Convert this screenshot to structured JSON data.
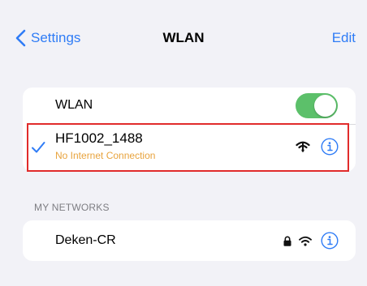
{
  "nav": {
    "back_label": "Settings",
    "title": "WLAN",
    "edit_label": "Edit"
  },
  "wlan_toggle": {
    "label": "WLAN",
    "on": true
  },
  "connected_network": {
    "name": "HF1002_1488",
    "status": "No Internet Connection",
    "icons": [
      "checkmark-icon",
      "wifi-no-internet-icon",
      "info-icon"
    ]
  },
  "my_networks": {
    "header": "MY NETWORKS",
    "items": [
      {
        "name": "Deken-CR",
        "secured": true,
        "icons": [
          "lock-icon",
          "wifi-icon",
          "info-icon"
        ]
      }
    ]
  },
  "colors": {
    "accent": "#2f7cf6",
    "toggle_on": "#5cc06a",
    "warning": "#e8a33d",
    "highlight": "#e12b2b",
    "background": "#f2f2f7"
  }
}
